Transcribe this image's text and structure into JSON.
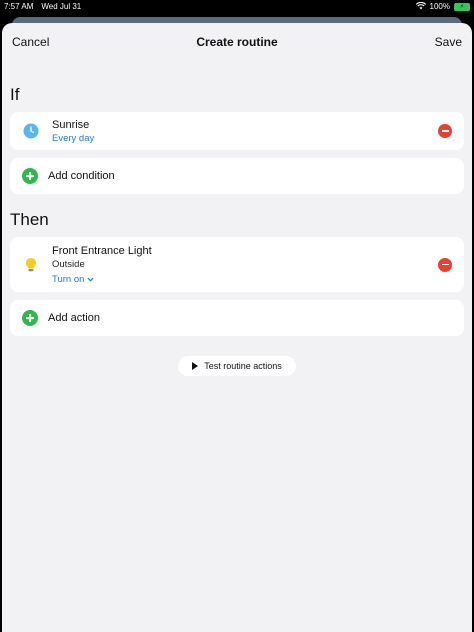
{
  "status_bar": {
    "time": "7:57 AM",
    "date": "Wed Jul 31",
    "battery": "100%"
  },
  "nav": {
    "cancel_label": "Cancel",
    "title": "Create routine",
    "save_label": "Save"
  },
  "if_section": {
    "heading": "If",
    "trigger": {
      "title": "Sunrise",
      "subtitle": "Every day",
      "icon": "sunrise-clock-icon"
    },
    "add_condition_label": "Add condition"
  },
  "then_section": {
    "heading": "Then",
    "action": {
      "title": "Front Entrance Light",
      "location": "Outside",
      "state": "Turn on",
      "icon": "light-bulb-icon"
    },
    "add_action_label": "Add action"
  },
  "test_button_label": "Test routine actions",
  "colors": {
    "accent": "#1e7ad6",
    "add": "#2fb84c",
    "remove": "#e8412f",
    "background": "#f2f2f4"
  }
}
